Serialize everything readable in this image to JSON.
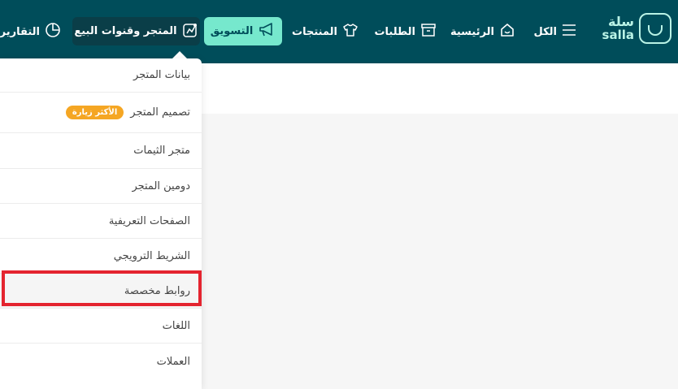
{
  "brand": {
    "name_ar": "سلة",
    "name_en": "salla"
  },
  "nav": {
    "all": "الكل",
    "home": "الرئيسية",
    "orders": "الطلبات",
    "products": "المنتجات",
    "marketing": "التسويق",
    "store": "المتجر وقنوات البيع",
    "reports": "التقارير"
  },
  "dropdown": {
    "items": [
      {
        "label": "بيانات المتجر"
      },
      {
        "label": "تصميم المتجر",
        "badge": "الأكثر زيارة"
      },
      {
        "label": "متجر الثيمات"
      },
      {
        "label": "دومين المتجر"
      },
      {
        "label": "الصفحات التعريفية"
      },
      {
        "label": "الشريط الترويجي"
      },
      {
        "label": "روابط مخصصة"
      },
      {
        "label": "اللغات"
      },
      {
        "label": "العملات"
      }
    ]
  },
  "colors": {
    "topbar": "#004d5a",
    "accent": "#76e8cd",
    "badge": "#f5a623",
    "highlight": "#e4242f"
  },
  "icons": [
    "menu-icon",
    "home-icon",
    "orders-icon",
    "shirt-icon",
    "megaphone-icon",
    "store-icon",
    "pie-chart-icon"
  ]
}
